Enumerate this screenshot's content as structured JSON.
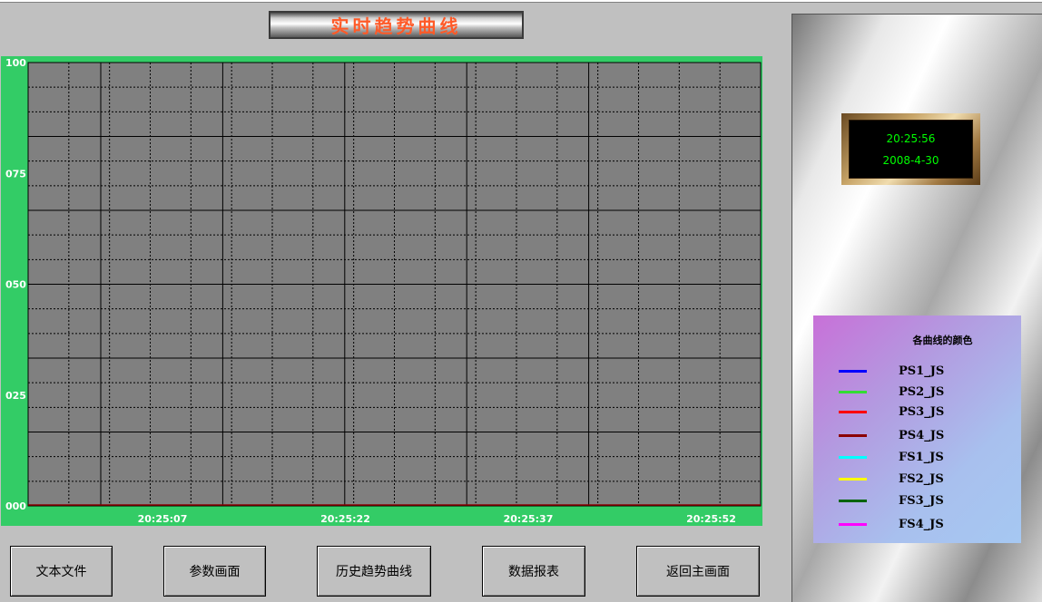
{
  "title": "实时趋势曲线",
  "clock": {
    "time": "20:25:56",
    "date": "2008-4-30"
  },
  "legend": {
    "title": "各曲线的颜色",
    "items": [
      {
        "label": "PS1_JS",
        "color": "#0000ff"
      },
      {
        "label": "PS2_JS",
        "color": "#33dd33"
      },
      {
        "label": "PS3_JS",
        "color": "#ff0000"
      },
      {
        "label": "PS4_JS",
        "color": "#8b0000"
      },
      {
        "label": "FS1_JS",
        "color": "#00ffff"
      },
      {
        "label": "FS2_JS",
        "color": "#ffff00"
      },
      {
        "label": "FS3_JS",
        "color": "#006400"
      },
      {
        "label": "FS4_JS",
        "color": "#ff00ff"
      }
    ]
  },
  "chart_data": {
    "type": "line",
    "y_ticks": [
      "100",
      "075",
      "050",
      "025",
      "000"
    ],
    "ylim": [
      0,
      100
    ],
    "x_ticks": [
      "20:25:07",
      "20:25:22",
      "20:25:37",
      "20:25:52"
    ],
    "background": "#808080",
    "frame_color": "#33cc66",
    "grid": true,
    "series": []
  },
  "buttons": [
    "文本文件",
    "参数画面",
    "历史趋势曲线",
    "数据报表",
    "返回主画面"
  ]
}
